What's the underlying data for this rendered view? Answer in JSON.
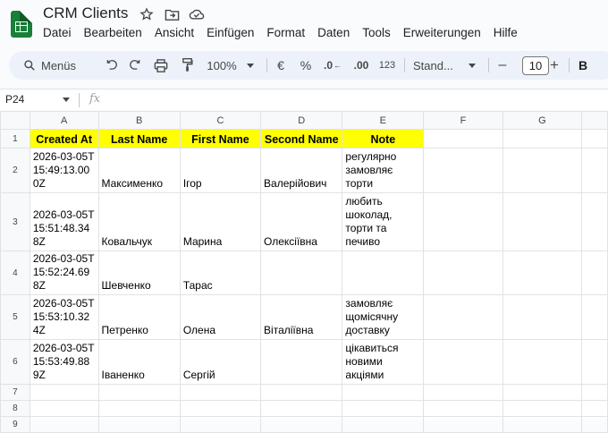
{
  "app": {
    "title": "CRM Clients",
    "menu": [
      "Datei",
      "Bearbeiten",
      "Ansicht",
      "Einfügen",
      "Format",
      "Daten",
      "Tools",
      "Erweiterungen",
      "Hilfe"
    ]
  },
  "toolbar": {
    "search_label": "Menüs",
    "zoom": "100%",
    "currency": "€",
    "percent": "%",
    "dec_decrease": ".0",
    "dec_increase": ".00",
    "number_format": "123",
    "font_name": "Stand...",
    "font_size": "10",
    "minus": "–",
    "plus": "+",
    "bold": "B"
  },
  "formula_bar": {
    "name_box": "P24",
    "fx": "fx"
  },
  "sheet": {
    "columns": [
      "A",
      "B",
      "C",
      "D",
      "E",
      "F",
      "G"
    ],
    "row_numbers": [
      "1",
      "2",
      "3",
      "4",
      "5",
      "6",
      "7",
      "8",
      "9"
    ],
    "headers": [
      "Created At",
      "Last Name",
      "First Name",
      "Second Name",
      "Note"
    ],
    "rows": [
      {
        "created": "2026-03-05T15:49:13.000Z",
        "last": "Максименко",
        "first": "Ігор",
        "second": "Валерійович",
        "note": "регулярно замовляє торти"
      },
      {
        "created": "2026-03-05T15:51:48.348Z",
        "last": "Ковальчук",
        "first": "Марина",
        "second": "Олексіївна",
        "note": "любить шоколад, торти та печиво"
      },
      {
        "created": "2026-03-05T15:52:24.698Z",
        "last": "Шевченко",
        "first": "Тарас",
        "second": "",
        "note": ""
      },
      {
        "created": "2026-03-05T15:53:10.324Z",
        "last": "Петренко",
        "first": "Олена",
        "second": "Віталіївна",
        "note": "замовляє щомісячну доставку"
      },
      {
        "created": "2026-03-05T15:53:49.889Z",
        "last": "Іваненко",
        "first": "Сергій",
        "second": "",
        "note": "цікавиться новими акціями"
      }
    ]
  },
  "colors": {
    "header_fill": "#ffff00",
    "logo_green": "#188038",
    "toolbar_bg": "#edf2fa"
  }
}
